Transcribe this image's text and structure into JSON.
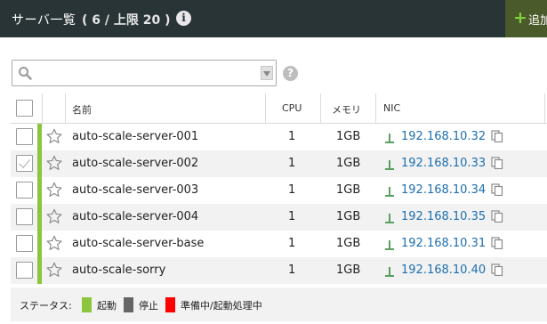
{
  "header": {
    "title": "サーバ一覧",
    "count": "( 6 / 上限 20 )",
    "info_icon": "i",
    "add_label": "追加"
  },
  "search": {
    "value": "",
    "placeholder": ""
  },
  "help_icon": "?",
  "columns": {
    "name": "名前",
    "cpu": "CPU",
    "memory": "メモリ",
    "nic": "NIC"
  },
  "rows": [
    {
      "name": "auto-scale-server-001",
      "cpu": "1",
      "memory": "1GB",
      "ip": "192.168.10.32",
      "selected": false
    },
    {
      "name": "auto-scale-server-002",
      "cpu": "1",
      "memory": "1GB",
      "ip": "192.168.10.33",
      "selected": true
    },
    {
      "name": "auto-scale-server-003",
      "cpu": "1",
      "memory": "1GB",
      "ip": "192.168.10.34",
      "selected": false
    },
    {
      "name": "auto-scale-server-004",
      "cpu": "1",
      "memory": "1GB",
      "ip": "192.168.10.35",
      "selected": false
    },
    {
      "name": "auto-scale-server-base",
      "cpu": "1",
      "memory": "1GB",
      "ip": "192.168.10.31",
      "selected": false
    },
    {
      "name": "auto-scale-sorry",
      "cpu": "1",
      "memory": "1GB",
      "ip": "192.168.10.40",
      "selected": false
    }
  ],
  "legend": {
    "label": "ステータス:",
    "items": [
      {
        "label": "起動",
        "color": "#8cc63f"
      },
      {
        "label": "停止",
        "color": "#666666"
      },
      {
        "label": "準備中/起動処理中",
        "color": "#ff0000"
      }
    ]
  },
  "colors": {
    "header_bg": "#283436",
    "status_running": "#8cc63f",
    "link": "#1c6fb0"
  }
}
